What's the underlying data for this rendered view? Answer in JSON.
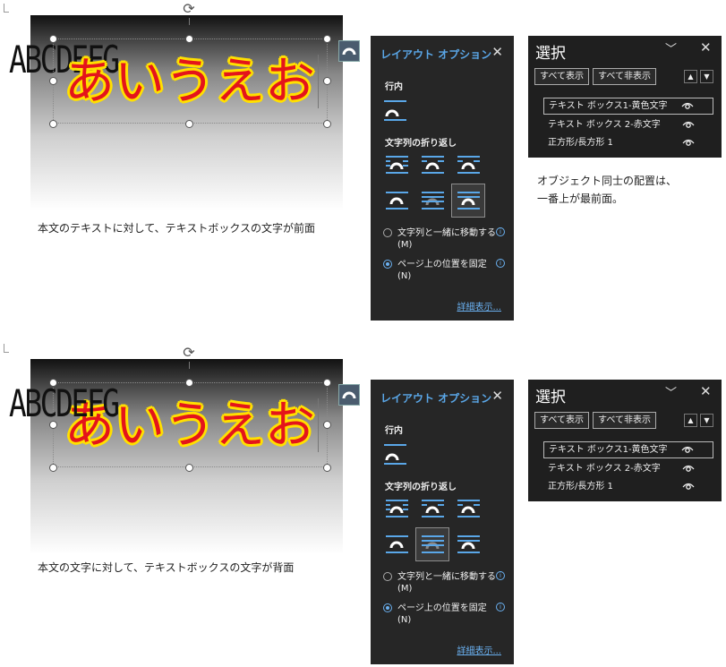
{
  "sections": [
    {
      "text_art_abc": "ABCDEFG",
      "text_art_aiueo": "あいうえお",
      "body_text": "本文のテキストに対して、テキストボックスの文字が前面",
      "layout_panel": {
        "title": "レイアウト オプション",
        "close": "✕",
        "inline_heading": "行内",
        "wrap_heading": "文字列の折り返し",
        "selected_wrap": 5,
        "radio_move": "文字列と一緒に移動する(M)",
        "radio_move_mnemonic": "M",
        "radio_fix": "ページ上の位置を固定(N)",
        "radio_fix_mnemonic": "N",
        "radio_selected": "fix",
        "more_link": "詳細表示..."
      },
      "selection_panel": {
        "title": "選択",
        "chevron": "﹀",
        "close": "✕",
        "show_all": "すべて表示",
        "hide_all": "すべて非表示",
        "items": [
          "テキスト ボックス1-黄色文字",
          "テキスト ボックス 2-赤文字",
          "正方形/長方形 1"
        ],
        "selected_item": 0
      },
      "note_lines": [
        "オブジェクト同士の配置は、",
        "一番上が最前面。"
      ]
    },
    {
      "text_art_abc": "ABCDEFG",
      "text_art_aiueo": "あいうえお",
      "body_text": "本文の文字に対して、テキストボックスの文字が背面",
      "layout_panel": {
        "title": "レイアウト オプション",
        "close": "✕",
        "inline_heading": "行内",
        "wrap_heading": "文字列の折り返し",
        "selected_wrap": 4,
        "radio_move": "文字列と一緒に移動する(M)",
        "radio_move_mnemonic": "M",
        "radio_fix": "ページ上の位置を固定(N)",
        "radio_fix_mnemonic": "N",
        "radio_selected": "fix",
        "more_link": "詳細表示..."
      },
      "selection_panel": {
        "title": "選択",
        "chevron": "﹀",
        "close": "✕",
        "show_all": "すべて表示",
        "hide_all": "すべて非表示",
        "items": [
          "テキスト ボックス1-黄色文字",
          "テキスト ボックス 2-赤文字",
          "正方形/長方形 1"
        ],
        "selected_item": 0
      }
    }
  ],
  "colors": {
    "panel_bg": "#262626",
    "accent_blue": "#5aa7e8",
    "text_red": "#e4141b",
    "text_yellow_outline": "#ffe000"
  }
}
